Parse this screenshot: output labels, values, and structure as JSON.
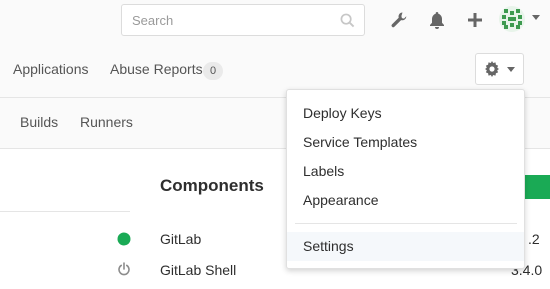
{
  "header": {
    "search": {
      "placeholder": "Search",
      "value": ""
    },
    "icons": [
      "search-icon",
      "wrench-icon",
      "bell-icon",
      "plus-icon",
      "avatar",
      "chevron-down-icon"
    ]
  },
  "admin_nav": {
    "tabs": [
      {
        "label": "Applications"
      },
      {
        "label": "Abuse Reports",
        "badge": "0"
      }
    ]
  },
  "sub_nav": {
    "tabs": [
      {
        "label": "Builds"
      },
      {
        "label": "Runners"
      }
    ]
  },
  "dropdown": {
    "items": [
      {
        "label": "Deploy Keys"
      },
      {
        "label": "Service Templates"
      },
      {
        "label": "Labels"
      },
      {
        "label": "Appearance"
      },
      {
        "label": "Settings"
      }
    ]
  },
  "components": {
    "title": "Components",
    "rows": [
      {
        "name": "GitLab",
        "version": ".2",
        "status": "online",
        "status_color": "#1aaa55"
      },
      {
        "name": "GitLab Shell",
        "version": "3.4.0",
        "status": "power",
        "status_color": "#8c8c8c"
      }
    ]
  },
  "colors": {
    "accent_green": "#1aaa55",
    "background": "#fafafa",
    "border": "#e5e5e5"
  }
}
